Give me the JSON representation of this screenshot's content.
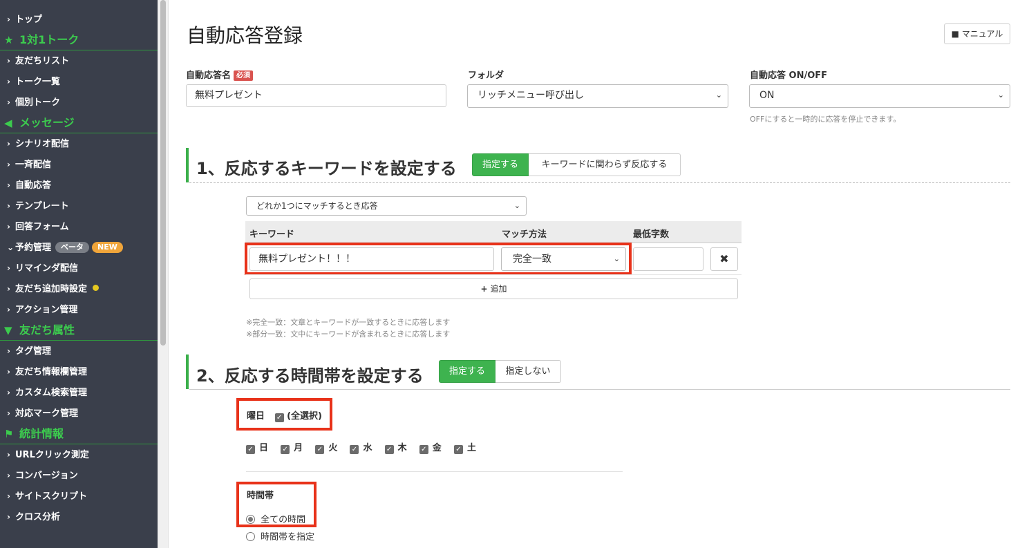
{
  "sidebar": {
    "items": [
      {
        "type": "item",
        "label": "トップ"
      },
      {
        "type": "head",
        "icon": "star-icon",
        "label": "1対1トーク"
      },
      {
        "type": "item",
        "label": "友だちリスト"
      },
      {
        "type": "item",
        "label": "トーク一覧"
      },
      {
        "type": "item",
        "label": "個別トーク"
      },
      {
        "type": "head",
        "icon": "megaphone-icon",
        "label": "メッセージ"
      },
      {
        "type": "item",
        "label": "シナリオ配信"
      },
      {
        "type": "item",
        "label": "一斉配信"
      },
      {
        "type": "item",
        "label": "自動応答"
      },
      {
        "type": "item",
        "label": "テンプレート"
      },
      {
        "type": "item",
        "label": "回答フォーム"
      },
      {
        "type": "item",
        "label": "予約管理",
        "expanded": true,
        "badge_beta": "ベータ",
        "badge_new": "NEW"
      },
      {
        "type": "item",
        "label": "リマインダ配信"
      },
      {
        "type": "item",
        "label": "友だち追加時設定",
        "dot": true
      },
      {
        "type": "item",
        "label": "アクション管理"
      },
      {
        "type": "head",
        "icon": "filter-icon",
        "label": "友だち属性"
      },
      {
        "type": "item",
        "label": "タグ管理"
      },
      {
        "type": "item",
        "label": "友だち情報欄管理"
      },
      {
        "type": "item",
        "label": "カスタム検索管理"
      },
      {
        "type": "item",
        "label": "対応マーク管理"
      },
      {
        "type": "head",
        "icon": "flag-icon",
        "label": "統計情報"
      },
      {
        "type": "item",
        "label": "URLクリック測定"
      },
      {
        "type": "item",
        "label": "コンバージョン"
      },
      {
        "type": "item",
        "label": "サイトスクリプト"
      },
      {
        "type": "item",
        "label": "クロス分析"
      }
    ]
  },
  "page": {
    "title": "自動応答登録",
    "manual_label": "マニュアル"
  },
  "form": {
    "name_label": "自動応答名",
    "required_badge": "必須",
    "name_value": "無料プレゼント",
    "folder_label": "フォルダ",
    "folder_value": "リッチメニュー呼び出し",
    "onoff_label": "自動応答 ON/OFF",
    "onoff_value": "ON",
    "onoff_help": "OFFにすると一時的に応答を停止できます。"
  },
  "section1": {
    "title": "1、反応するキーワードを設定する",
    "btn_on": "指定する",
    "btn_off": "キーワードに関わらず反応する",
    "match_mode": "どれか1つにマッチするとき応答",
    "col_keyword": "キーワード",
    "col_match": "マッチ方法",
    "col_min": "最低字数",
    "keyword_value": "無料プレゼント！！！",
    "match_value": "完全一致",
    "min_value": "",
    "add_label": "追加",
    "note1": "※完全一致：文章とキーワードが一致するときに応答します",
    "note2": "※部分一致：文中にキーワードが含まれるときに応答します"
  },
  "section2": {
    "title": "2、反応する時間帯を設定する",
    "btn_on": "指定する",
    "btn_off": "指定しない",
    "weekday_label": "曜日",
    "select_all": "(全選択)",
    "days": [
      "日",
      "月",
      "火",
      "水",
      "木",
      "金",
      "土"
    ],
    "time_label": "時間帯",
    "time_all": "全ての時間",
    "time_specify": "時間帯を指定"
  },
  "colors": {
    "sidebar_bg": "#3a3f4b",
    "accent_green": "#3eb34f",
    "highlight_red": "#e8321a"
  }
}
